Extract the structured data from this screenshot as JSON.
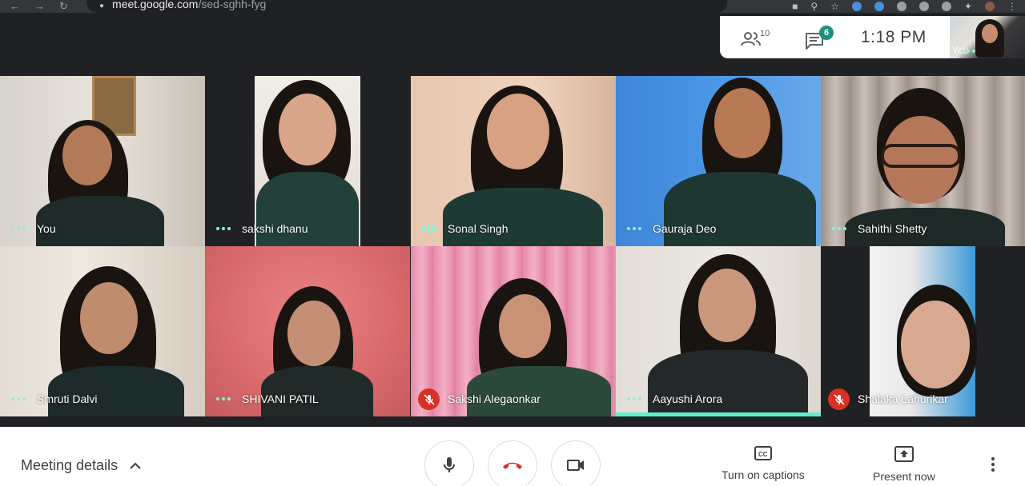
{
  "browser": {
    "url_host": "meet.google.com",
    "url_path": "/sed-sghh-fyg",
    "nav_icons": [
      "back-arrow-icon",
      "forward-arrow-icon",
      "reload-icon"
    ],
    "extension_icons": [
      "camera-icon",
      "zoom-icon",
      "star-icon",
      "extension-icon",
      "extension-icon",
      "grammarly-icon",
      "extension-icon",
      "check-icon",
      "puzzle-icon",
      "profile-avatar",
      "kebab-menu-icon"
    ]
  },
  "infobar": {
    "people_count": "10",
    "chat_badge": "6",
    "time": "1:18  PM"
  },
  "self_view": {
    "label": "You"
  },
  "participants": [
    {
      "name": "You",
      "status": "dots",
      "active": false
    },
    {
      "name": "sakshi dhanu",
      "status": "dots",
      "active": false
    },
    {
      "name": "Sonal Singh",
      "status": "speaking",
      "active": false
    },
    {
      "name": "Gauraja Deo",
      "status": "dots",
      "active": false
    },
    {
      "name": "Sahithi Shetty",
      "status": "dots",
      "active": false
    },
    {
      "name": "Smruti Dalvi",
      "status": "dots",
      "active": false
    },
    {
      "name": "SHIVANI PATIL",
      "status": "dots",
      "active": false
    },
    {
      "name": "Sakshi Alegaonkar",
      "status": "muted",
      "active": false
    },
    {
      "name": "Aayushi Arora",
      "status": "dots",
      "active": true
    },
    {
      "name": "Shalaka Lahurikar",
      "status": "muted",
      "active": false
    }
  ],
  "toolbar": {
    "meeting_details": "Meeting details",
    "captions": "Turn on captions",
    "present": "Present now"
  },
  "colors": {
    "accent_teal": "#8ef0d6",
    "active_speaker_bar": "#5ff0cb",
    "muted_red": "#d93025",
    "hangup_red": "#d93025",
    "chat_badge": "#1e8e7e"
  }
}
